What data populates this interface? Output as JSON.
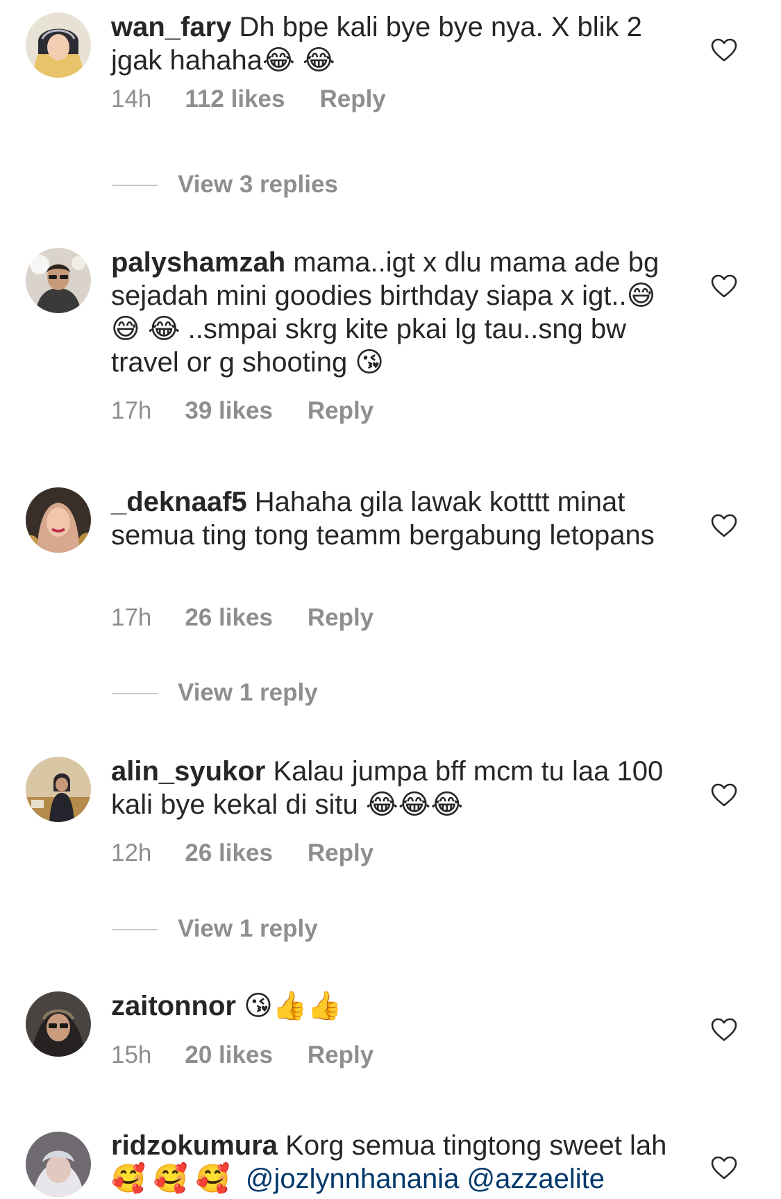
{
  "comments": [
    {
      "username": "wan_fary",
      "text": "Dh bpe kali bye bye nya. X blik 2 jgak hahaha😂 😂",
      "time": "14h",
      "likes": "112 likes",
      "reply_label": "Reply",
      "view_replies": "View 3 replies"
    },
    {
      "username": "palyshamzah",
      "text": "mama..igt x dlu mama ade bg sejadah mini goodies birthday siapa x igt..😅 😅 😂 ..smpai skrg kite pkai lg tau..sng bw travel or g shooting 😘",
      "time": "17h",
      "likes": "39 likes",
      "reply_label": "Reply"
    },
    {
      "username": "_deknaaf5",
      "text": "Hahaha gila lawak kotttt minat semua ting tong teamm bergabung letopans",
      "time": "17h",
      "likes": "26 likes",
      "reply_label": "Reply",
      "view_replies": "View 1 reply"
    },
    {
      "username": "alin_syukor",
      "text": "Kalau jumpa bff mcm tu laa 100 kali bye kekal di situ 😂😂😂",
      "time": "12h",
      "likes": "26 likes",
      "reply_label": "Reply",
      "view_replies": "View 1 reply"
    },
    {
      "username": "zaitonnor",
      "text": "😘👍👍",
      "time": "15h",
      "likes": "20 likes",
      "reply_label": "Reply"
    },
    {
      "username": "ridzokumura",
      "text": "Korg semua tingtong sweet lah🥰 🥰 🥰",
      "mentions": [
        "@jozlynnhanania",
        "@azzaelite"
      ]
    }
  ],
  "icons": {
    "like": "heart-outline-icon",
    "avatar": "avatar-photo"
  },
  "colors": {
    "text": "#262626",
    "secondary": "#8e8e8e",
    "mention": "#00376b",
    "divider": "#c7c7c7"
  }
}
